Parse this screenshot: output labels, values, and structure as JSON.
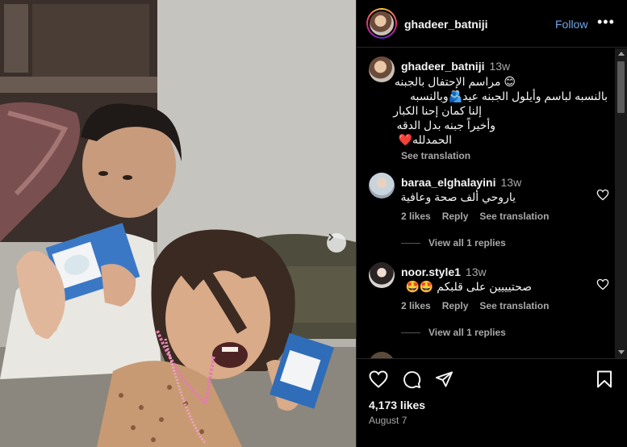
{
  "post": {
    "username": "ghadeer_batniji",
    "follow_label": "Follow",
    "more_label": "•••",
    "caption": {
      "username": "ghadeer_batniji",
      "time": "13w",
      "lines": [
        "😊 مراسم الإحتفال بالجبنه",
        "بالنسبه لباسم وأيلول الجبنه عيد🫂وبالنسبه",
        "إلنا كمان إحنا الكبار",
        "وأخيراً جبنه بدل الدقه",
        "الحمدلله❤️"
      ],
      "see_translation": "See translation"
    },
    "comments": [
      {
        "username": "baraa_elghalayini",
        "time": "13w",
        "text": "ياروحي ألف صحة وعافية",
        "likes": "2 likes",
        "reply": "Reply",
        "see_translation": "See translation",
        "view_replies": "View all 1 replies"
      },
      {
        "username": "noor.style1",
        "time": "13w",
        "text": "صحتيييين على قلبكم 🤩🤩",
        "likes": "2 likes",
        "reply": "Reply",
        "see_translation": "See translation",
        "view_replies": "View all 1 replies"
      }
    ],
    "likes": "4,173 likes",
    "date": "August 7"
  },
  "icons": {
    "like": "heart-icon",
    "comment": "comment-icon",
    "share": "paper-plane-icon",
    "save": "bookmark-icon",
    "next": "chevron-right-icon"
  },
  "colors": {
    "background": "#000000",
    "text": "#f5f5f5",
    "muted": "#a8a8a8",
    "link": "#6ea8e6"
  }
}
